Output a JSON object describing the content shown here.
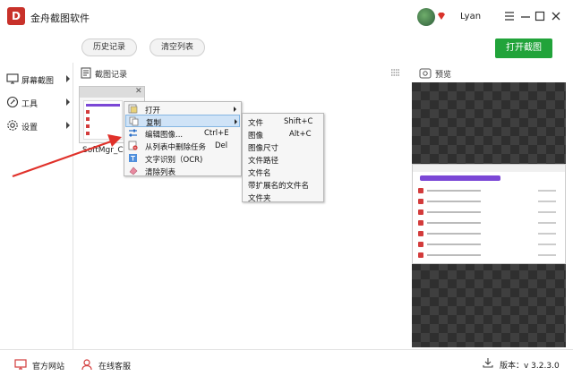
{
  "app": {
    "title": "金舟截图软件",
    "logo_char": "D"
  },
  "user": {
    "name": "Lyan"
  },
  "toolbar": {
    "history_label": "历史记录",
    "clear_label": "清空列表",
    "open_capture_label": "打开截图"
  },
  "sidebar": {
    "items": [
      {
        "label": "屏幕截图"
      },
      {
        "label": "工具"
      },
      {
        "label": "设置"
      }
    ]
  },
  "records": {
    "header": "截图记录",
    "thumbnail_name": "SoftMgr_C"
  },
  "preview": {
    "header": "预览"
  },
  "context_menu": {
    "items": [
      {
        "label": "打开",
        "shortcut": ""
      },
      {
        "label": "复制",
        "shortcut": ""
      },
      {
        "label": "编辑图像...",
        "shortcut": "Ctrl+E"
      },
      {
        "label": "从列表中删除任务",
        "shortcut": "Del"
      },
      {
        "label": "文字识别（OCR)",
        "shortcut": ""
      },
      {
        "label": "清除列表",
        "shortcut": ""
      }
    ]
  },
  "copy_submenu": {
    "items": [
      {
        "label": "文件",
        "shortcut": "Shift+C"
      },
      {
        "label": "图像",
        "shortcut": "Alt+C"
      },
      {
        "label": "图像尺寸",
        "shortcut": ""
      },
      {
        "label": "文件路径",
        "shortcut": ""
      },
      {
        "label": "文件名",
        "shortcut": ""
      },
      {
        "label": "带扩展名的文件名",
        "shortcut": ""
      },
      {
        "label": "文件夹",
        "shortcut": ""
      }
    ]
  },
  "statusbar": {
    "website_label": "官方网站",
    "support_label": "在线客服",
    "version_label": "版本：v 3.2.3.0"
  },
  "colors": {
    "primary": "#21a33a",
    "logo": "#c8312a",
    "arrow": "#e0312a",
    "highlight": "#cfe3f7"
  }
}
